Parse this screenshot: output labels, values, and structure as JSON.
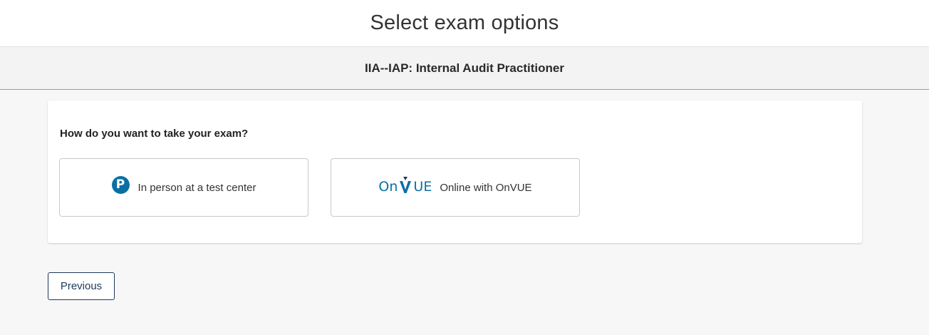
{
  "header": {
    "title": "Select exam options"
  },
  "exam": {
    "name": "IIA--IAP: Internal Audit Practitioner"
  },
  "options_card": {
    "question": "How do you want to take your exam?",
    "options": [
      {
        "label": "In person at a test center",
        "icon": "pearson-p-icon"
      },
      {
        "label": "Online with OnVUE",
        "icon": "onvue-logo"
      }
    ],
    "onvue_logo_text_left": "On",
    "onvue_logo_text_right": "UE"
  },
  "nav": {
    "previous_label": "Previous"
  },
  "colors": {
    "brand_blue": "#0b6fa4",
    "button_navy": "#1b3a5c"
  }
}
